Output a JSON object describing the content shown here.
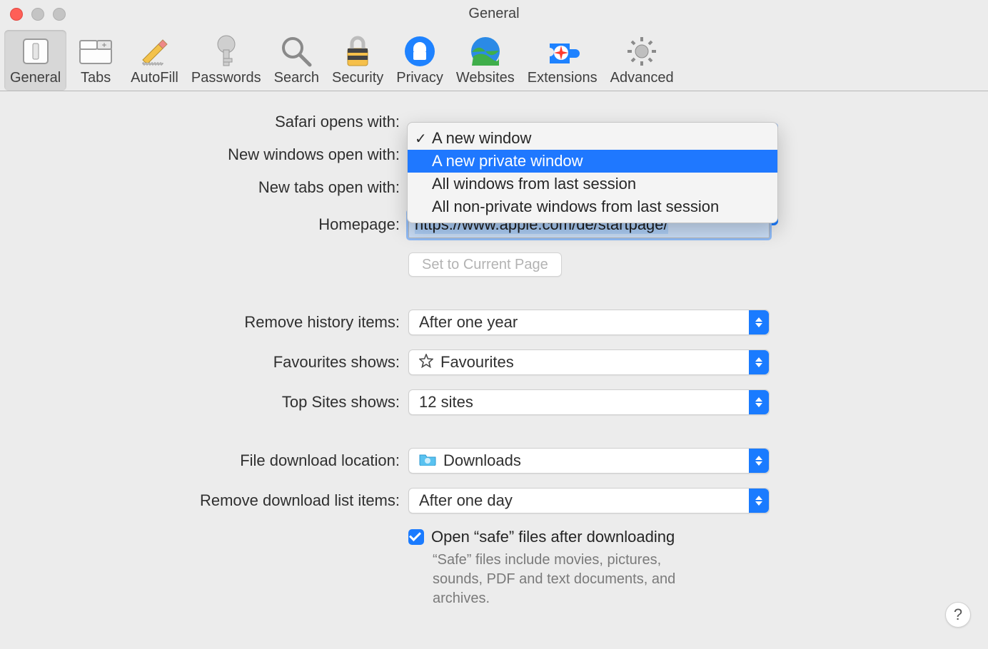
{
  "window": {
    "title": "General"
  },
  "toolbar": [
    {
      "id": "general",
      "label": "General"
    },
    {
      "id": "tabs",
      "label": "Tabs"
    },
    {
      "id": "autofill",
      "label": "AutoFill"
    },
    {
      "id": "passwords",
      "label": "Passwords"
    },
    {
      "id": "search",
      "label": "Search"
    },
    {
      "id": "security",
      "label": "Security"
    },
    {
      "id": "privacy",
      "label": "Privacy"
    },
    {
      "id": "websites",
      "label": "Websites"
    },
    {
      "id": "extensions",
      "label": "Extensions"
    },
    {
      "id": "advanced",
      "label": "Advanced"
    }
  ],
  "labels": {
    "safari_opens_with": "Safari opens with:",
    "new_windows": "New windows open with:",
    "new_tabs": "New tabs open with:",
    "homepage": "Homepage:",
    "set_current": "Set to Current Page",
    "remove_history": "Remove history items:",
    "favourites_shows": "Favourites shows:",
    "topsites_shows": "Top Sites shows:",
    "download_location": "File download location:",
    "remove_download": "Remove download list items:",
    "open_safe": "Open “safe” files after downloading",
    "safe_desc": "“Safe” files include movies, pictures, sounds, PDF and text documents, and archives."
  },
  "values": {
    "homepage": "https://www.apple.com/de/startpage/",
    "remove_history": "After one year",
    "favourites": "Favourites",
    "topsites": "12 sites",
    "download_location": "Downloads",
    "remove_download": "After one day"
  },
  "safari_opens_menu": {
    "options": [
      "A new window",
      "A new private window",
      "All windows from last session",
      "All non-private windows from last session"
    ],
    "checked_index": 0,
    "highlight_index": 1
  },
  "help_label": "?"
}
